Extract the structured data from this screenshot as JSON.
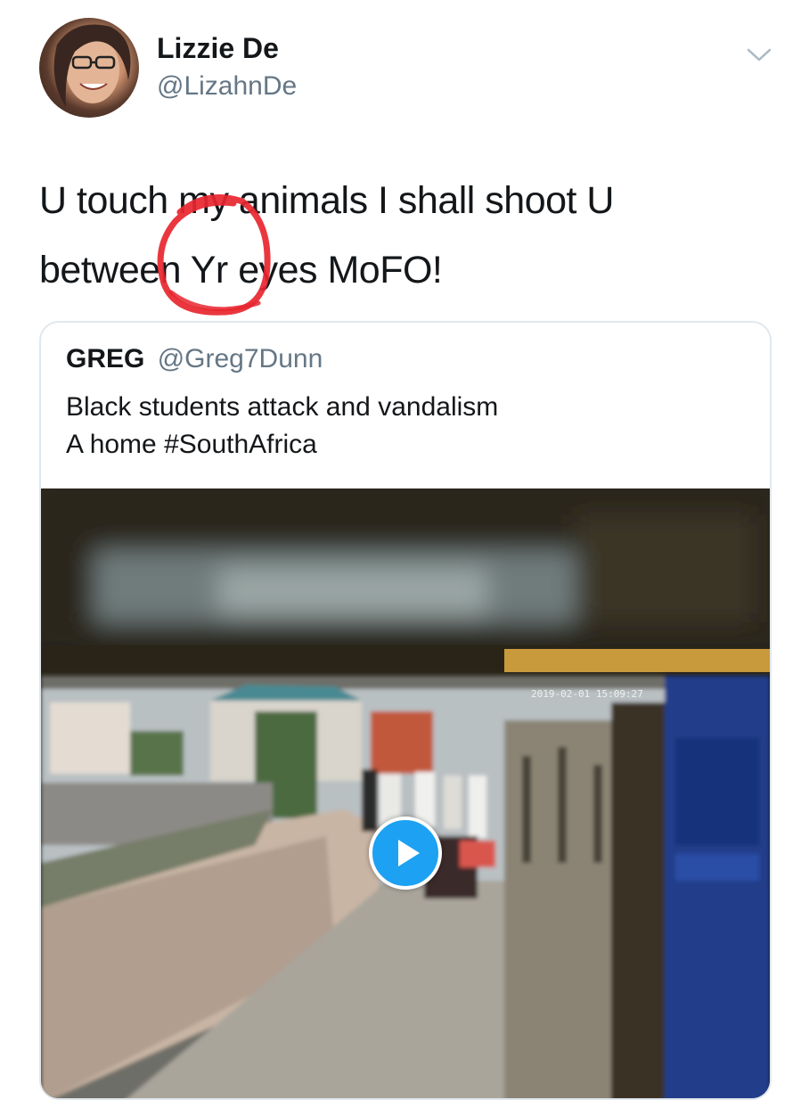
{
  "tweet": {
    "author_name": "Lizzie De",
    "author_handle": "@LizahnDe",
    "text_line1": "U touch my animals I shall shoot U",
    "text_line2": "between Yr eyes MoFO!"
  },
  "quoted_tweet": {
    "author_name": "GREG",
    "author_handle": "@Greg7Dunn",
    "text": "Black students attack and vandalism\nA home #SouthAfrica"
  },
  "media": {
    "type": "video",
    "cctv_timestamp": "2019-02-01 15:09:27"
  },
  "colors": {
    "accent": "#1da1f2",
    "annotation": "#e8262f",
    "secondary_text": "#657786",
    "border": "#e1e8ed"
  },
  "icons": {
    "menu": "chevron-down-icon",
    "play": "play-icon",
    "avatar": "avatar"
  }
}
